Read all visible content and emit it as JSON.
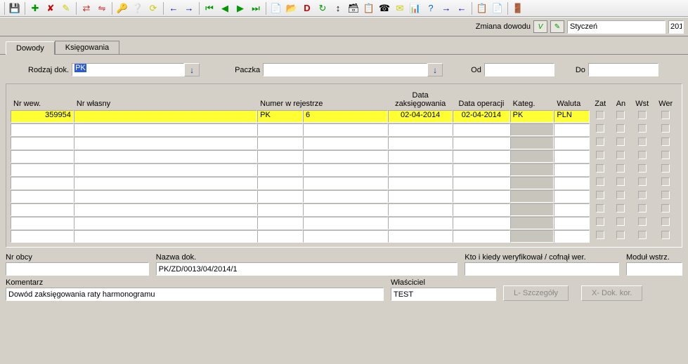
{
  "toolbar_icons": [
    "💾",
    "➕",
    "✖",
    "✎",
    "⇔",
    "⇋",
    "🔑",
    "❓",
    "🔄",
    "←",
    "→",
    "⏮",
    "◀",
    "▶",
    "⏭",
    "📄",
    "📂",
    "D",
    "↻",
    "↕",
    "🗃",
    "📋",
    "📠",
    "✉",
    "📊",
    "?",
    "→",
    "←",
    "📋",
    "📄",
    "🚪"
  ],
  "header": {
    "label": "Zmiana dowodu",
    "month": "Styczeń",
    "year": "201"
  },
  "tabs": {
    "dowody": "Dowody",
    "ksiegowania": "Księgowania"
  },
  "filters": {
    "rodzaj_label": "Rodzaj dok.",
    "rodzaj_value": "PK",
    "paczka_label": "Paczka",
    "paczka_value": "",
    "od_label": "Od",
    "od_value": "",
    "do_label": "Do",
    "do_value": ""
  },
  "columns": {
    "nr_wew": "Nr wew.",
    "nr_wlasny": "Nr własny",
    "numer_rej": "Numer w rejestrze",
    "data_zaks": "Data zaksięgowania",
    "data_op": "Data operacji",
    "kateg": "Kateg.",
    "waluta": "Waluta",
    "zat": "Zat",
    "an": "An",
    "wst": "Wst",
    "wer": "Wer"
  },
  "row1": {
    "nr_wew": "359954",
    "nr_wlasny": "",
    "rej1": "PK",
    "rej2": "6",
    "data_zaks": "02-04-2014",
    "data_op": "02-04-2014",
    "kateg": "PK",
    "waluta": "PLN"
  },
  "details": {
    "nr_obcy_label": "Nr obcy",
    "nr_obcy_value": "",
    "nazwa_label": "Nazwa dok.",
    "nazwa_value": "PK/ZD/0013/04/2014/1",
    "kto_label": "Kto i kiedy weryfikował / cofnął wer.",
    "kto_value": "",
    "modul_label": "Moduł wstrz.",
    "modul_value": "",
    "komentarz_label": "Komentarz",
    "komentarz_value": "Dowód zaksięgowania raty harmonogramu",
    "wlasciciel_label": "Właściciel",
    "wlasciciel_value": "TEST",
    "szczegoly_btn": "L- Szczegóły",
    "dokkor_btn": "X- Dok. kor."
  }
}
